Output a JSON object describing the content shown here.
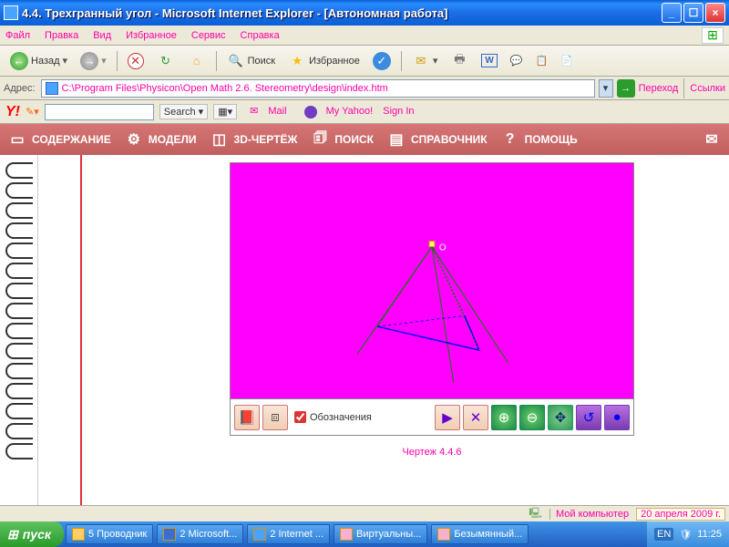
{
  "window": {
    "title": "4.4. Трехгранный угол - Microsoft Internet Explorer - [Автономная работа]"
  },
  "menu": {
    "file": "Файл",
    "edit": "Правка",
    "view": "Вид",
    "fav": "Избранное",
    "service": "Сервис",
    "help": "Справка"
  },
  "toolbar": {
    "back": "Назад",
    "search": "Поиск",
    "favorites": "Избранное"
  },
  "address": {
    "label": "Адрес:",
    "value": "C:\\Program Files\\Physicon\\Open Math 2.6. Stereometry\\design\\index.htm",
    "go": "Переход",
    "links": "Ссылки"
  },
  "yahoo": {
    "logo": "Y!",
    "search": "Search",
    "mail": "Mail",
    "my": "My Yahoo!",
    "signin": "Sign In"
  },
  "appnav": {
    "contents": "СОДЕРЖАНИЕ",
    "models": "МОДЕЛИ",
    "drawing": "3D-ЧЕРТЁЖ",
    "search": "ПОИСК",
    "reference": "СПРАВОЧНИК",
    "help": "ПОМОЩЬ"
  },
  "figure": {
    "vertex": "O",
    "labels_cb": "Обозначения",
    "caption": "Чертеж 4.4.6"
  },
  "status": {
    "mycomputer": "Мой компьютер",
    "date": "20 апреля 2009 г."
  },
  "taskbar": {
    "start": "пуск",
    "tasks": [
      {
        "label": "5 Проводник"
      },
      {
        "label": "2 Microsoft..."
      },
      {
        "label": "2 Internet ..."
      },
      {
        "label": "Виртуальны..."
      },
      {
        "label": "Безымянный..."
      }
    ],
    "lang": "EN",
    "time": "11:25"
  }
}
